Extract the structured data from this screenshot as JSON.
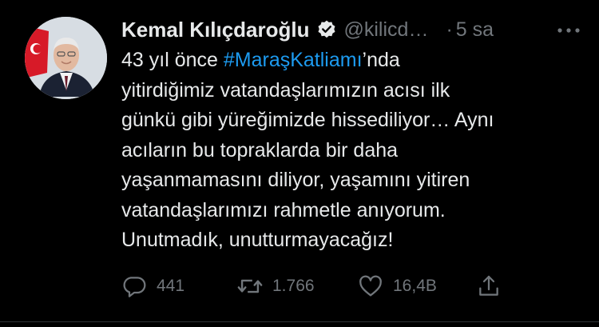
{
  "author": {
    "name": "Kemal Kılıçdaroğlu",
    "handle": "@kilicd…",
    "verified": true
  },
  "meta": {
    "separator": "·",
    "time": "5 sa"
  },
  "tweet": {
    "line1_pre": "43 yıl önce ",
    "hashtag": "#MaraşKatliamı",
    "line1_post": "’nda",
    "line2": "yitirdiğimiz vatandaşlarımızın acısı ilk",
    "line3": "günkü gibi yüreğimizde hissediliyor… Aynı",
    "line4": "acıların bu topraklarda bir daha",
    "line5": "yaşanmamasını diliyor, yaşamını yitiren",
    "line6": "vatandaşlarımızı rahmetle anıyorum.",
    "line7": "Unutmadık, unutturmayacağız!"
  },
  "actions": {
    "reply_count": "441",
    "retweet_count": "1.766",
    "like_count": "16,4B",
    "share_icon": "share-icon"
  },
  "colors": {
    "background": "#000000",
    "text": "#e7e9ea",
    "muted": "#71767b",
    "link": "#1d9bf0"
  }
}
